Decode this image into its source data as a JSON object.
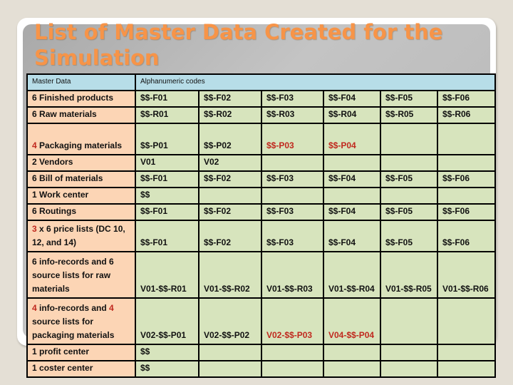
{
  "slide": {
    "title": "List of Master Data Created for the Simulation"
  },
  "table": {
    "headers": [
      "Master Data",
      "Alphanumeric codes"
    ],
    "rows": [
      {
        "label_num": "6",
        "label_text": " Finished products",
        "num_red": false,
        "codes": [
          "$$-F01",
          "$$-F02",
          "$$-F03",
          "$$-F04",
          "$$-F05",
          "$$-F06"
        ],
        "red_from": 6
      },
      {
        "label_num": "6",
        "label_text": " Raw materials",
        "num_red": false,
        "codes": [
          "$$-R01",
          "$$-R02",
          "$$-R03",
          "$$-R04",
          "$$-R05",
          "$$-R06"
        ],
        "red_from": 6
      },
      {
        "label_num": "4",
        "label_text": " Packaging materials",
        "num_red": true,
        "codes": [
          "$$-P01",
          "$$-P02",
          "$$-P03",
          "$$-P04",
          "",
          ""
        ],
        "red_from": 2
      },
      {
        "label_num": "2",
        "label_text": " Vendors",
        "num_red": false,
        "codes": [
          "V01",
          "V02",
          "",
          "",
          "",
          ""
        ],
        "red_from": 6
      },
      {
        "label_num": "6",
        "label_text": " Bill of materials",
        "num_red": false,
        "codes": [
          "$$-F01",
          "$$-F02",
          "$$-F03",
          "$$-F04",
          "$$-F05",
          "$$-F06"
        ],
        "red_from": 6
      },
      {
        "label_num": "1",
        "label_text": " Work center",
        "num_red": false,
        "codes": [
          "$$",
          "",
          "",
          "",
          "",
          ""
        ],
        "red_from": 6
      },
      {
        "label_num": "6",
        "label_text": " Routings",
        "num_red": false,
        "codes": [
          "$$-F01",
          "$$-F02",
          "$$-F03",
          "$$-F04",
          "$$-F05",
          "$$-F06"
        ],
        "red_from": 6
      },
      {
        "label_num": "3",
        "label_text": " x 6 price lists (DC 10, 12, and 14)",
        "num_red": true,
        "codes": [
          "$$-F01",
          "$$-F02",
          "$$-F03",
          "$$-F04",
          "$$-F05",
          "$$-F06"
        ],
        "red_from": 6
      },
      {
        "label_num": "6",
        "label_text": " info-records and 6 source lists for raw materials",
        "num_red": false,
        "codes": [
          "V01-$$-R01",
          "V01-$$-R02",
          "V01-$$-R03",
          "V01-$$-R04",
          "V01-$$-R05",
          "V01-$$-R06"
        ],
        "red_from": 6
      },
      {
        "label_num": "4",
        "label_mid": " info-records and ",
        "label_num2": "4",
        "label_text": " source lists for packaging materials",
        "num_red": true,
        "codes": [
          "V02-$$-P01",
          "V02-$$-P02",
          "V02-$$-P03",
          "V04-$$-P04",
          "",
          ""
        ],
        "red_from": 2
      },
      {
        "label_num": "1",
        "label_text": " profit center",
        "num_red": false,
        "codes": [
          "$$",
          "",
          "",
          "",
          "",
          ""
        ],
        "red_from": 6
      },
      {
        "label_num": "1",
        "label_text": " coster center",
        "num_red": false,
        "codes": [
          "$$",
          "",
          "",
          "",
          "",
          ""
        ],
        "red_from": 6
      }
    ]
  },
  "colors": {
    "title": "#f79448",
    "header_bg": "#b7dde8",
    "label_bg": "#fcd5b5",
    "code_bg": "#d7e4bd",
    "highlight_red": "#c0281e"
  }
}
